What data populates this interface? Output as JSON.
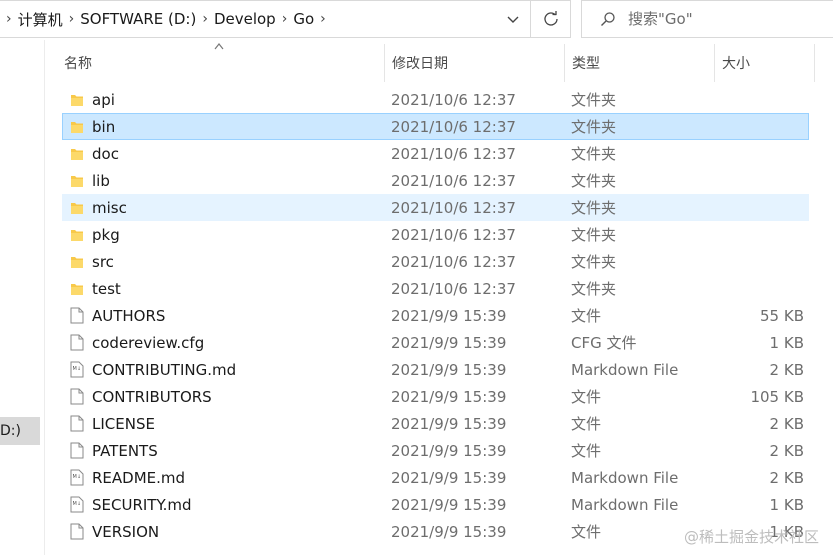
{
  "address": {
    "crumbs": [
      "计算机",
      "SOFTWARE (D:)",
      "Develop",
      "Go"
    ]
  },
  "search": {
    "placeholder": "搜索\"Go\""
  },
  "nav": {
    "selected_label": "D:)"
  },
  "columns": {
    "name": "名称",
    "date": "修改日期",
    "type": "类型",
    "size": "大小"
  },
  "files": [
    {
      "name": "api",
      "date": "2021/10/6 12:37",
      "type": "文件夹",
      "size": "",
      "kind": "folder"
    },
    {
      "name": "bin",
      "date": "2021/10/6 12:37",
      "type": "文件夹",
      "size": "",
      "kind": "folder",
      "state": "selected"
    },
    {
      "name": "doc",
      "date": "2021/10/6 12:37",
      "type": "文件夹",
      "size": "",
      "kind": "folder"
    },
    {
      "name": "lib",
      "date": "2021/10/6 12:37",
      "type": "文件夹",
      "size": "",
      "kind": "folder"
    },
    {
      "name": "misc",
      "date": "2021/10/6 12:37",
      "type": "文件夹",
      "size": "",
      "kind": "folder",
      "state": "hover"
    },
    {
      "name": "pkg",
      "date": "2021/10/6 12:37",
      "type": "文件夹",
      "size": "",
      "kind": "folder"
    },
    {
      "name": "src",
      "date": "2021/10/6 12:37",
      "type": "文件夹",
      "size": "",
      "kind": "folder"
    },
    {
      "name": "test",
      "date": "2021/10/6 12:37",
      "type": "文件夹",
      "size": "",
      "kind": "folder"
    },
    {
      "name": "AUTHORS",
      "date": "2021/9/9 15:39",
      "type": "文件",
      "size": "55 KB",
      "kind": "file"
    },
    {
      "name": "codereview.cfg",
      "date": "2021/9/9 15:39",
      "type": "CFG 文件",
      "size": "1 KB",
      "kind": "file"
    },
    {
      "name": "CONTRIBUTING.md",
      "date": "2021/9/9 15:39",
      "type": "Markdown File",
      "size": "2 KB",
      "kind": "markdown"
    },
    {
      "name": "CONTRIBUTORS",
      "date": "2021/9/9 15:39",
      "type": "文件",
      "size": "105 KB",
      "kind": "file"
    },
    {
      "name": "LICENSE",
      "date": "2021/9/9 15:39",
      "type": "文件",
      "size": "2 KB",
      "kind": "file"
    },
    {
      "name": "PATENTS",
      "date": "2021/9/9 15:39",
      "type": "文件",
      "size": "2 KB",
      "kind": "file"
    },
    {
      "name": "README.md",
      "date": "2021/9/9 15:39",
      "type": "Markdown File",
      "size": "2 KB",
      "kind": "markdown"
    },
    {
      "name": "SECURITY.md",
      "date": "2021/9/9 15:39",
      "type": "Markdown File",
      "size": "1 KB",
      "kind": "markdown"
    },
    {
      "name": "VERSION",
      "date": "2021/9/9 15:39",
      "type": "文件",
      "size": "1 KB",
      "kind": "file"
    }
  ],
  "colors": {
    "folder": "#f8c94a",
    "selected_bg": "#cce8ff",
    "hover_bg": "#e5f3ff"
  },
  "watermark": "@稀土掘金技术社区"
}
